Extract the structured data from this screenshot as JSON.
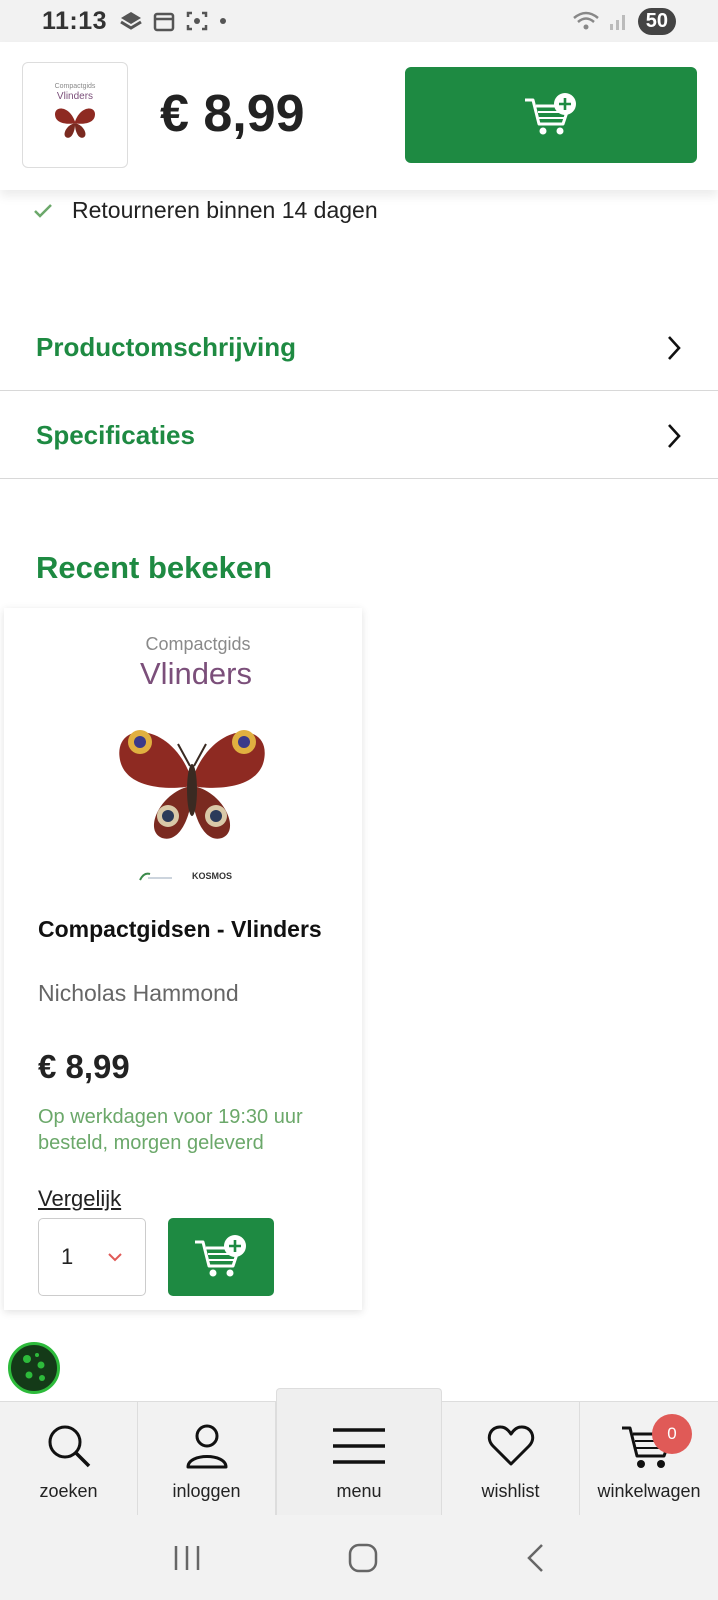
{
  "status_bar": {
    "time": "11:13",
    "battery": "50"
  },
  "header": {
    "thumb_title_small": "Compactgids",
    "thumb_title": "Vlinders",
    "price": "€ 8,99",
    "cart_icon": "cart-plus-icon"
  },
  "return_policy": {
    "icon": "check-icon",
    "text": "Retourneren binnen 14 dagen"
  },
  "accordions": [
    {
      "label": "Productomschrijving",
      "icon": "chevron-right-icon"
    },
    {
      "label": "Specificaties",
      "icon": "chevron-right-icon"
    }
  ],
  "recent": {
    "title": "Recent bekeken",
    "product": {
      "cover_small": "Compactgids",
      "cover_title": "Vlinders",
      "cover_publisher": "KOSMOS",
      "title": "Compactgidsen - Vlinders",
      "author": "Nicholas Hammond",
      "price": "€ 8,99",
      "delivery": "Op werkdagen voor 19:30 uur besteld, morgen geleverd",
      "compare": "Vergelijk",
      "quantity": "1"
    }
  },
  "bottom_nav": [
    {
      "label": "zoeken",
      "icon": "search-icon"
    },
    {
      "label": "inloggen",
      "icon": "user-icon"
    },
    {
      "label": "menu",
      "icon": "menu-icon"
    },
    {
      "label": "wishlist",
      "icon": "heart-icon"
    },
    {
      "label": "winkelwagen",
      "icon": "cart-icon",
      "badge": "0"
    }
  ],
  "colors": {
    "brand_green": "#1e8a42",
    "badge_red": "#e05a57",
    "delivery_green": "#6ba86a"
  }
}
